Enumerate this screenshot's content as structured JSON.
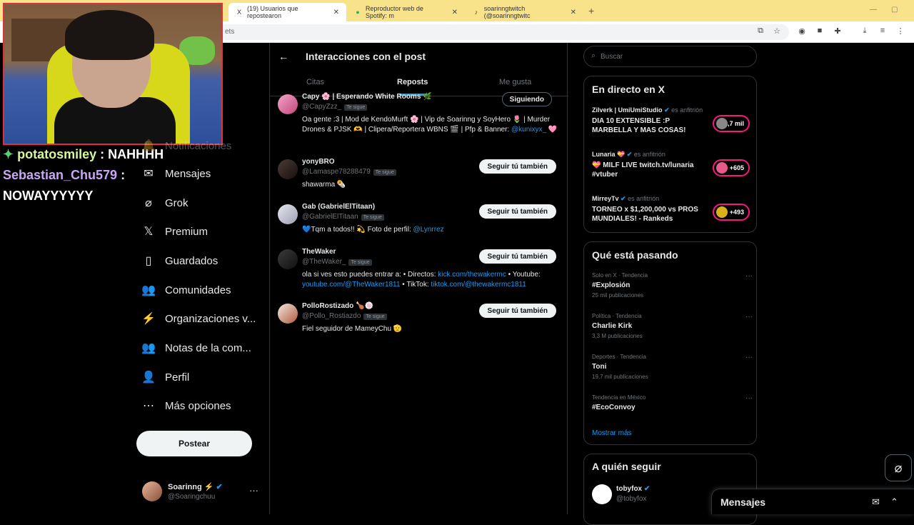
{
  "browser": {
    "tabs": [
      {
        "title": "(19) Usuarios que repostearon",
        "icon": "X"
      },
      {
        "title": "Reproductor web de Spotify: m",
        "icon": "●"
      },
      {
        "title": "soarinngtwitch (@soarinngtwitc",
        "icon": "♪"
      }
    ],
    "new_tab": "+",
    "url": "ets"
  },
  "stream": {
    "chat": [
      {
        "user": "potatosmiley",
        "sep": " : ",
        "text": "NAHHHH"
      },
      {
        "user": "Sebastian_Chu579",
        "sep": " : ",
        "text": ""
      },
      {
        "user": "",
        "sep": "",
        "text": "NOWAYYYYYY"
      }
    ]
  },
  "nav": {
    "items": [
      {
        "label": "Notificaciones",
        "icon": "🔔"
      },
      {
        "label": "Mensajes",
        "icon": "✉"
      },
      {
        "label": "Grok",
        "icon": "⌀"
      },
      {
        "label": "Premium",
        "icon": "𝕏"
      },
      {
        "label": "Guardados",
        "icon": "▯"
      },
      {
        "label": "Comunidades",
        "icon": "👥"
      },
      {
        "label": "Organizaciones v...",
        "icon": "⚡"
      },
      {
        "label": "Notas de la com...",
        "icon": "👥"
      },
      {
        "label": "Perfil",
        "icon": "👤"
      },
      {
        "label": "Más opciones",
        "icon": "⋯"
      }
    ],
    "post_button": "Postear",
    "account": {
      "name": "Soarinng ⚡",
      "handle": "@Soaringchuu",
      "more": "···"
    }
  },
  "main": {
    "back": "←",
    "title": "Interacciones con el post",
    "tabs": [
      "Citas",
      "Reposts",
      "Me gusta"
    ],
    "active_tab": "Reposts",
    "users": [
      {
        "name": "Capy 🌸 | Esperando White Rooms 🌿",
        "handle": "@CapyZzz_",
        "badge": "Te sigue",
        "button": "Siguiendo",
        "bio": "Oa gente :3 | Mod de KendoMurft 🌸 | Vip de Soarinng y SoyHero 🌷 | Murder Drones & PJSK 🫶 | Clipera/Reportera WBNS 🎬 | Pfp & Banner:",
        "bio_link": "@kunixyx_",
        "bio_tail": " 🩷"
      },
      {
        "name": "yonyBRO",
        "handle": "@Lamaspe78288479",
        "badge": "Te sigue",
        "button": "Seguir tú también",
        "bio": "shawarma 🌯"
      },
      {
        "name": "Gab (GabrielElTitaan)",
        "handle": "@GabrielElTitaan",
        "badge": "Te sigue",
        "button": "Seguir tú también",
        "bio": "💙Tqm a todos!! 💫 Foto de perfil: ",
        "bio_link": "@Lynrrez"
      },
      {
        "name": "TheWaker",
        "handle": "@TheWaker_",
        "badge": "Te sigue",
        "button": "Seguir tú también",
        "bio_a": "ola si ves esto puedes entrar a: • Directos: ",
        "link_a": "kick.com/thewakermc",
        "bio_b": " • Youtube:",
        "link_b": "youtube.com/@TheWaker1811",
        "bio_c": " • TikTok: ",
        "link_c": "tiktok.com/@thewakermc1811"
      },
      {
        "name": "PolloRostizado 🍗🍥",
        "handle": "@Pollo_Rostiazdo",
        "badge": "Te sigue",
        "button": "Seguir tú también",
        "bio": "Fiel seguidor de MameyChu 🫡"
      }
    ]
  },
  "sidebar": {
    "search_placeholder": "Buscar",
    "live_title": "En directo en X",
    "live": [
      {
        "host": "Zilverk | UmiUmiStudio",
        "role": "es anfitrión",
        "title": "DIA 10 EXTENSIBLE :P MARBELLA Y MAS COSAS!",
        "count": "+1,7 mil"
      },
      {
        "host": "Lunaria 💝",
        "role": "es anfitrión",
        "title": "💝 MILF LIVE twitch.tv/lunaria #vtuber",
        "count": "+605"
      },
      {
        "host": "MirreyTv",
        "role": "es anfitrión",
        "title": "TORNEO x $1,200,000 vs PROS MUNDIALES! - Rankeds",
        "count": "+493"
      }
    ],
    "trends_title": "Qué está pasando",
    "trends": [
      {
        "category": "Solo en X · Tendencia",
        "name": "#Explosión",
        "count": "25 mil publicaciones"
      },
      {
        "category": "Política · Tendencia",
        "name": "Charlie Kirk",
        "count": "3,3 M publicaciones"
      },
      {
        "category": "Deportes · Tendencia",
        "name": "Toni",
        "count": "19,7 mil publicaciones"
      },
      {
        "category": "Tendencia en México",
        "name": "#EcoConvoy",
        "count": ""
      }
    ],
    "show_more": "Mostrar más",
    "who_title": "A quién seguir",
    "who": {
      "name": "tobyfox",
      "handle": "@tobyfox"
    }
  },
  "messages_bar": {
    "title": "Mensajes"
  },
  "colors": {
    "accent": "#1d9bf0",
    "live_ring": "#f91880",
    "browser_bar": "#f9e38a"
  }
}
